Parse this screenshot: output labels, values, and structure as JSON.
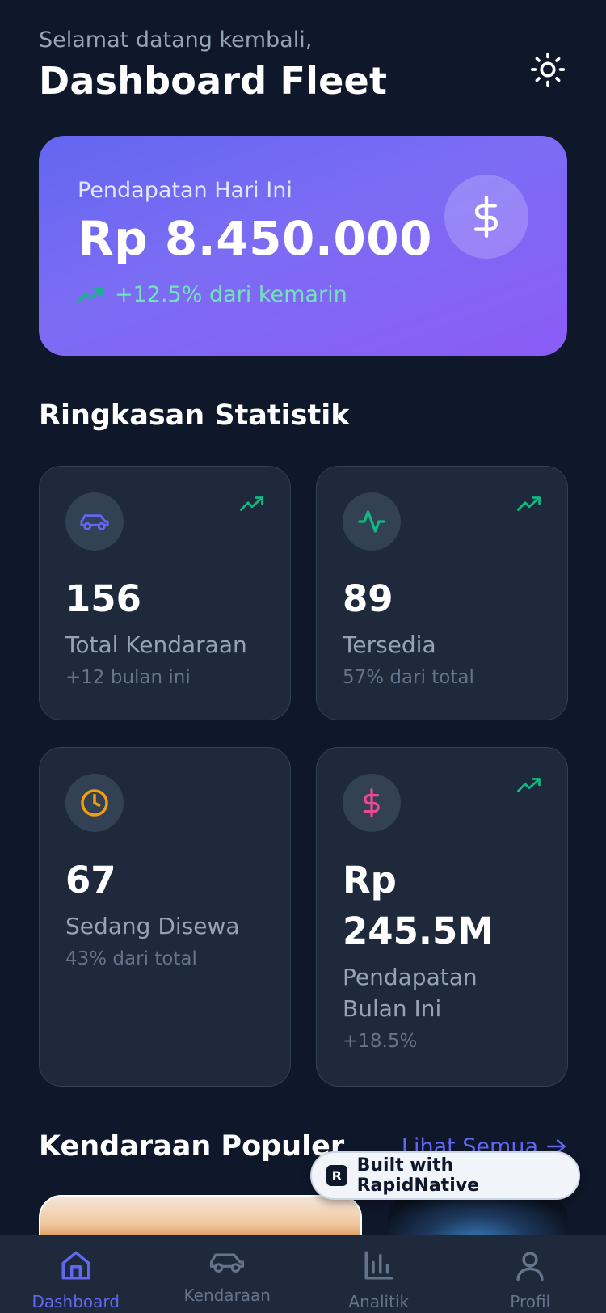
{
  "header": {
    "greeting": "Selamat datang kembali,",
    "title": "Dashboard Fleet",
    "theme_icon": "sun-icon"
  },
  "revenue": {
    "label": "Pendapatan Hari Ini",
    "value": "Rp 8.450.000",
    "trend": "+12.5% dari kemarin",
    "icon": "dollar-icon"
  },
  "stats": {
    "title": "Ringkasan Statistik",
    "cards": [
      {
        "value": "156",
        "label": "Total Kendaraan",
        "sub": "+12 bulan ini",
        "icon": "car-icon",
        "color": "#6366f1",
        "trend": true
      },
      {
        "value": "89",
        "label": "Tersedia",
        "sub": "57% dari total",
        "icon": "activity-icon",
        "color": "#10b981",
        "trend": true
      },
      {
        "value": "67",
        "label": "Sedang Disewa",
        "sub": "43% dari total",
        "icon": "clock-icon",
        "color": "#f59e0b",
        "trend": false
      },
      {
        "value": "Rp 245.5M",
        "label": "Pendapatan Bulan Ini",
        "sub": "+18.5%",
        "icon": "dollar-icon",
        "color": "#ec4899",
        "trend": true
      }
    ]
  },
  "popular": {
    "title": "Kendaraan Populer",
    "see_all": "Lihat Semua"
  },
  "badge": {
    "text": "Built with RapidNative"
  },
  "tabs": [
    {
      "label": "Dashboard",
      "icon": "home-icon",
      "active": true
    },
    {
      "label": "Kendaraan",
      "icon": "car-icon",
      "active": false
    },
    {
      "label": "Analitik",
      "icon": "bar-chart-icon",
      "active": false
    },
    {
      "label": "Profil",
      "icon": "user-icon",
      "active": false
    }
  ],
  "colors": {
    "background": "#0f172a",
    "card": "#1e293b",
    "accent": "#6366f1",
    "success": "#10b981"
  }
}
